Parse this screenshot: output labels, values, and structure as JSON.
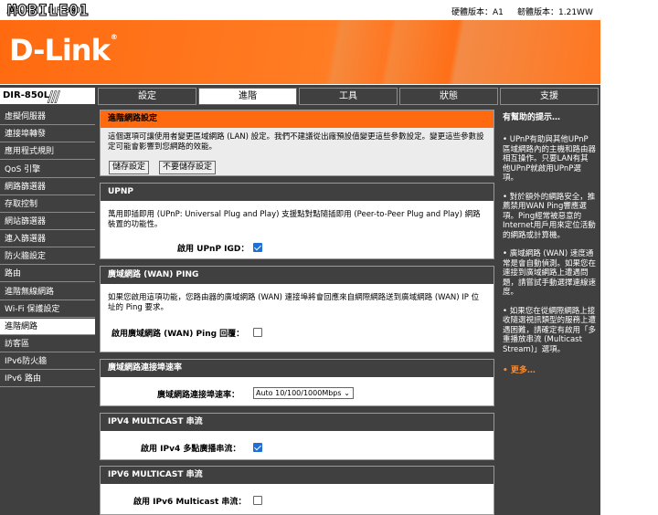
{
  "topbar": {
    "product_page": "產品頁面：DIR-850L",
    "hw_version": "硬體版本：A1",
    "fw_version": "韌體版本：1.21WW",
    "watermark": "MOBILE01"
  },
  "brand": {
    "logo": "D-Link",
    "reg": "®",
    "model": "DIR-850L"
  },
  "tabs": [
    {
      "label": "設定"
    },
    {
      "label": "進階"
    },
    {
      "label": "工具"
    },
    {
      "label": "狀態"
    },
    {
      "label": "支援"
    }
  ],
  "sidebar": {
    "items": [
      {
        "label": "虛擬伺服器"
      },
      {
        "label": "連接埠轉發"
      },
      {
        "label": "應用程式規則"
      },
      {
        "label": "QoS 引擎"
      },
      {
        "label": "網路篩選器"
      },
      {
        "label": "存取控制"
      },
      {
        "label": "網站篩選器"
      },
      {
        "label": "連入篩選器"
      },
      {
        "label": "防火牆設定"
      },
      {
        "label": "路由"
      },
      {
        "label": "進階無線網路"
      },
      {
        "label": "Wi-Fi 保護設定"
      },
      {
        "label": "進階網路"
      },
      {
        "label": "訪客區"
      },
      {
        "label": "IPv6防火牆"
      },
      {
        "label": "IPv6 路由"
      }
    ]
  },
  "intro": {
    "title": "進階網路設定",
    "text": "這個選項可讓使用者變更區域網路 (LAN) 設定。我們不建議從出廠預設值變更這些參數設定。變更這些參數設定可能會影響到您網路的效能。",
    "save_label": "儲存設定",
    "nosave_label": "不要儲存設定"
  },
  "upnp": {
    "header": "UPNP",
    "text": "萬用即插即用 (UPnP: Universal Plug and Play) 支援點對點隨插即用 (Peer-to-Peer Plug and Play) 網路裝置的功能性。",
    "enable_label": "啟用 UPnP IGD：",
    "enabled": true
  },
  "wan_ping": {
    "header": "廣域網路 (WAN) PING",
    "text": "如果您啟用這項功能，您路由器的廣域網路 (WAN) 連接埠將會回應來自網際網路送到廣域網路 (WAN) IP 位址的 Ping 要求。",
    "enable_label": "啟用廣域網路 (WAN) Ping 回覆：",
    "enabled": false
  },
  "wan_speed": {
    "header": "廣域網路連接埠速率",
    "label": "廣域網路連接埠速率：",
    "value": "Auto 10/100/1000Mbps"
  },
  "ipv4_mc": {
    "header": "IPV4 MULTICAST 串流",
    "label": "啟用 IPv4 多點廣播串流：",
    "enabled": true
  },
  "ipv6_mc": {
    "header": "IPV6 MULTICAST 串流",
    "label": "啟用 IPv6 Multicast 串流：",
    "enabled": false
  },
  "help": {
    "title": "有幫助的提示…",
    "tips": [
      "UPnP有助與其他UPnP區域網路內的主機和路由器相互操作。只要LAN有其他UPnP就啟用UPnP選項。",
      "對於額外的網路安全，推薦禁用WAN Ping響應選項。Ping經常被惡意的Internet用戶用來定位活動的網路或計算機。",
      "廣域網路 (WAN) 速度通常是會自動偵測。如果您在連接到廣域網路上遭遇問題，請嘗試手動選擇連線速度。",
      "如果您在從網際網路上接收隨選視訊類型的服務上遭遇困難，請確定有啟用「多重播放串流 (Multicast Stream)」選項。"
    ],
    "more": "更多…"
  }
}
